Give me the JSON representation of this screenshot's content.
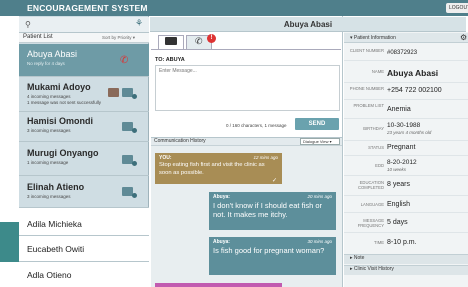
{
  "app": {
    "title": "ENCOURAGEMENT SYSTEM",
    "logout_label": "LOGOUT"
  },
  "patient_list": {
    "label": "Patient List",
    "sort_label": "Sort by Priority ▾",
    "patients": [
      {
        "name": "Abuya Abasi",
        "sub": "No reply for 4 days",
        "active": true
      },
      {
        "name": "Mukami Adoyo",
        "sub": "4 incoming messages",
        "sub2": "1 message was not sent successfully"
      },
      {
        "name": "Hamisi Omondi",
        "sub": "3 incoming messages"
      },
      {
        "name": "Murugi Onyango",
        "sub": "1 incoming message"
      },
      {
        "name": "Elinah Atieno",
        "sub": "3 incoming messages"
      },
      {
        "name": "Adila Michieka"
      },
      {
        "name": "Eucabeth Owiti"
      },
      {
        "name": "Adla Otieno"
      }
    ]
  },
  "conversation": {
    "patient_title": "Abuya Abasi",
    "alert_count": "!",
    "to_label": "TO: ABUYA",
    "placeholder": "Enter Message...",
    "char_count": "0 / 160 characters, 1 message",
    "send_label": "SEND",
    "history_label": "Communication History",
    "history_filter": "Dialogue View ▾",
    "messages": [
      {
        "sender": "YOU:",
        "time": "12 mins ago",
        "text": "Stop eating fish first and visit the clinic as soon as possible."
      },
      {
        "sender": "Abuya:",
        "time": "20 mins ago",
        "text": "I don't know if I should eat fish or not.  It makes me itchy."
      },
      {
        "sender": "Abuya:",
        "time": "30 mins ago",
        "text": "Is fish good for pregnant woman?"
      }
    ]
  },
  "patient_info": {
    "title": "▾ Patient Information",
    "rows": [
      {
        "label": "CLIENT NUMBER",
        "value": "#08372923"
      },
      {
        "label": "NAME",
        "value": "Abuya Abasi"
      },
      {
        "label": "PHONE NUMBER",
        "value": "+254 722 002100"
      },
      {
        "label": "PROBLEM LIST",
        "value": "Anemia"
      },
      {
        "label": "BIRTHDAY",
        "value": "10-30-1988",
        "sub": "23 years 4 months old"
      },
      {
        "label": "STATUS",
        "value": "Pregnant"
      },
      {
        "label": "EDD",
        "value": "8-20-2012",
        "sub": "10 weeks"
      },
      {
        "label": "EDUCATION COMPLETED",
        "value": "8 years"
      },
      {
        "label": "LANGUAGE",
        "value": "English"
      },
      {
        "label": "MESSAGE FREQUENCY",
        "value": "5 days"
      },
      {
        "label": "TIME",
        "value": "8-10 p.m."
      }
    ],
    "note_label": "▸ Note",
    "visit_label": "▸ Clinic Visit History"
  }
}
